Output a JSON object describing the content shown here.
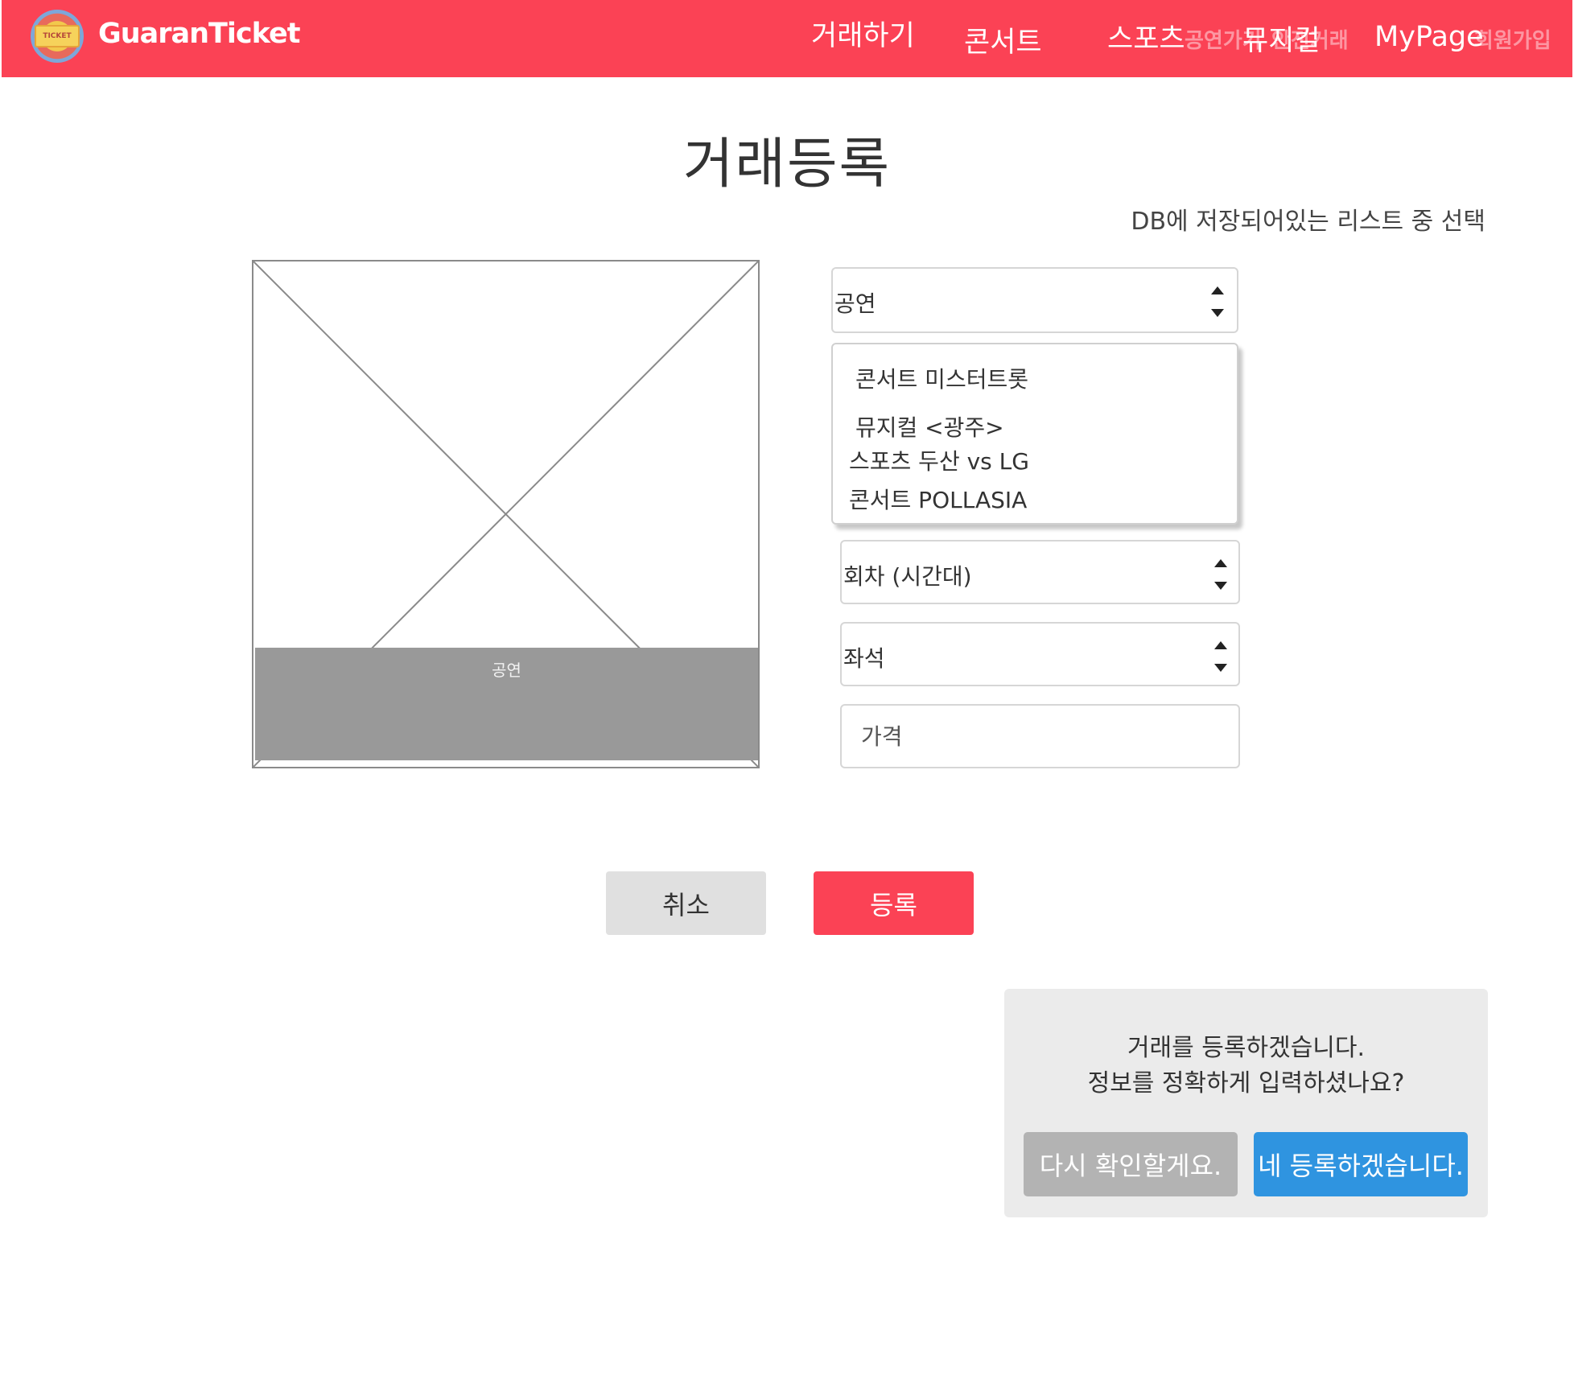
{
  "header": {
    "logo_text": "TICKET",
    "brand": "GuaranTicket",
    "nav": {
      "trade": "거래하기",
      "concert": "콘서트",
      "sports": "스포츠",
      "musical": "뮤지컬",
      "mypage": "MyPage"
    },
    "faint_nav": {
      "performance": "공연가기",
      "safe_trade": "안전거래",
      "signup": "회원가입"
    }
  },
  "page": {
    "title": "거래등록",
    "db_note": "DB에 저장되어있는 리스트 중 선택"
  },
  "image_placeholder": {
    "caption": "공연"
  },
  "form": {
    "performance_select": {
      "value": "공연"
    },
    "performance_options": [
      "콘서트 미스터트롯",
      "뮤지컬 <광주>",
      "스포츠 두산 vs LG",
      "콘서트 POLLASIA"
    ],
    "session_select": {
      "value": "회차 (시간대)"
    },
    "seat_select": {
      "value": "좌석"
    },
    "price_input": {
      "placeholder": "가격",
      "value": ""
    }
  },
  "actions": {
    "cancel": "취소",
    "register": "등록"
  },
  "dialog": {
    "line1": "거래를 등록하겠습니다.",
    "line2": "정보를 정확하게 입력하셨나요?",
    "back_label": "다시 확인할게요.",
    "confirm_label": "네 등록하겠습니다."
  },
  "colors": {
    "accent": "#fb4255",
    "confirm": "#2f94e0",
    "muted_button": "#b3b3b3"
  }
}
